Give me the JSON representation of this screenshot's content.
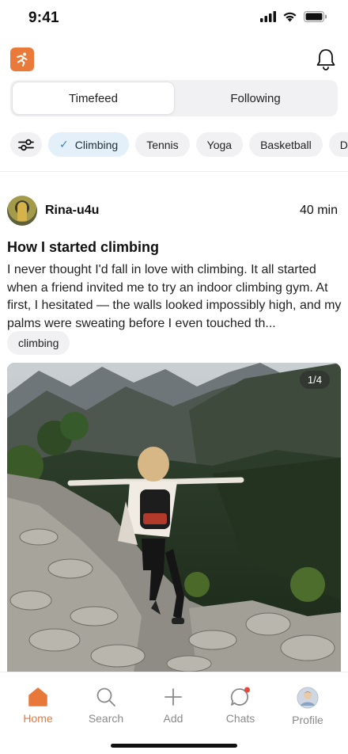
{
  "status_bar": {
    "time": "9:41"
  },
  "header": {
    "logo_icon": "running-person-icon",
    "notifications_icon": "bell-icon"
  },
  "feed_tabs": [
    {
      "label": "Timefeed",
      "active": true
    },
    {
      "label": "Following",
      "active": false
    }
  ],
  "categories": [
    {
      "label": "Climbing",
      "selected": true
    },
    {
      "label": "Tennis",
      "selected": false
    },
    {
      "label": "Yoga",
      "selected": false
    },
    {
      "label": "Basketball",
      "selected": false
    },
    {
      "label": "D",
      "selected": false
    }
  ],
  "post": {
    "author": "Rina-u4u",
    "time_ago": "40 min",
    "title": "How I started climbing",
    "body": "I never thought I'd fall in love with climbing. It all started when a friend invited me to try an indoor climbing gym. At first, I hesitated — the walls looked impossibly high, and my palms were sweating before I even touched th...",
    "tag": "climbing",
    "photo_counter": "1/4"
  },
  "tab_bar": [
    {
      "label": "Home",
      "icon": "home-icon",
      "active": true
    },
    {
      "label": "Search",
      "icon": "search-icon",
      "active": false
    },
    {
      "label": "Add",
      "icon": "plus-icon",
      "active": false
    },
    {
      "label": "Chats",
      "icon": "chat-bubble-icon",
      "active": false
    },
    {
      "label": "Profile",
      "icon": "profile-avatar",
      "active": false
    }
  ],
  "colors": {
    "accent": "#e8773a",
    "selected_chip": "#e3f0f9",
    "check": "#3a86c4",
    "notification_dot": "#e5483a"
  }
}
